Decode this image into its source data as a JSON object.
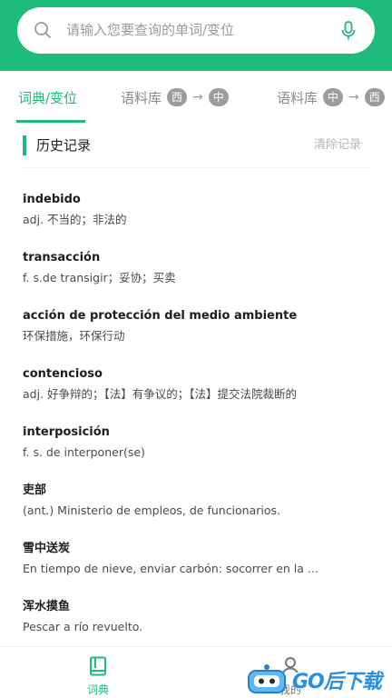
{
  "search": {
    "placeholder": "请输入您要查询的单词/变位",
    "search_icon": "search-icon",
    "mic_icon": "microphone-icon"
  },
  "tabs": [
    {
      "label": "词典/变位",
      "active": true
    },
    {
      "label": "语料库",
      "from": "西",
      "to": "中"
    },
    {
      "label": "语料库",
      "from": "中",
      "to": "西"
    }
  ],
  "history": {
    "title": "历史记录",
    "clear_label": "清除记录"
  },
  "entries": [
    {
      "word": "indebido",
      "definition": "adj. 不当的；非法的"
    },
    {
      "word": "transacción",
      "definition": "f. s.de transigir；妥协；买卖"
    },
    {
      "word": "acción de protección del medio ambiente",
      "definition": "环保措施，环保行动"
    },
    {
      "word": "contencioso",
      "definition": "adj. 好争辩的；【法】有争议的；【法】提交法院裁断的"
    },
    {
      "word": "interposición",
      "definition": "f. s. de interponer(se)"
    },
    {
      "word": "吏部",
      "definition": "(ant.) Ministerio de empleos, de funcionarios."
    },
    {
      "word": "雪中送炭",
      "definition": "En tiempo de nieve, enviar carbón: socorrer en la ..."
    },
    {
      "word": "浑水摸鱼",
      "definition": "Pescar a río revuelto."
    }
  ],
  "bottom_nav": {
    "dict_label": "词典",
    "mine_label": "我的",
    "dict_icon": "book-icon",
    "mine_icon": "user-icon"
  },
  "watermark": {
    "text": "GO后下载"
  },
  "colors": {
    "brand_green": "#1fbb7a",
    "pill_gray": "#9c9c9c"
  }
}
